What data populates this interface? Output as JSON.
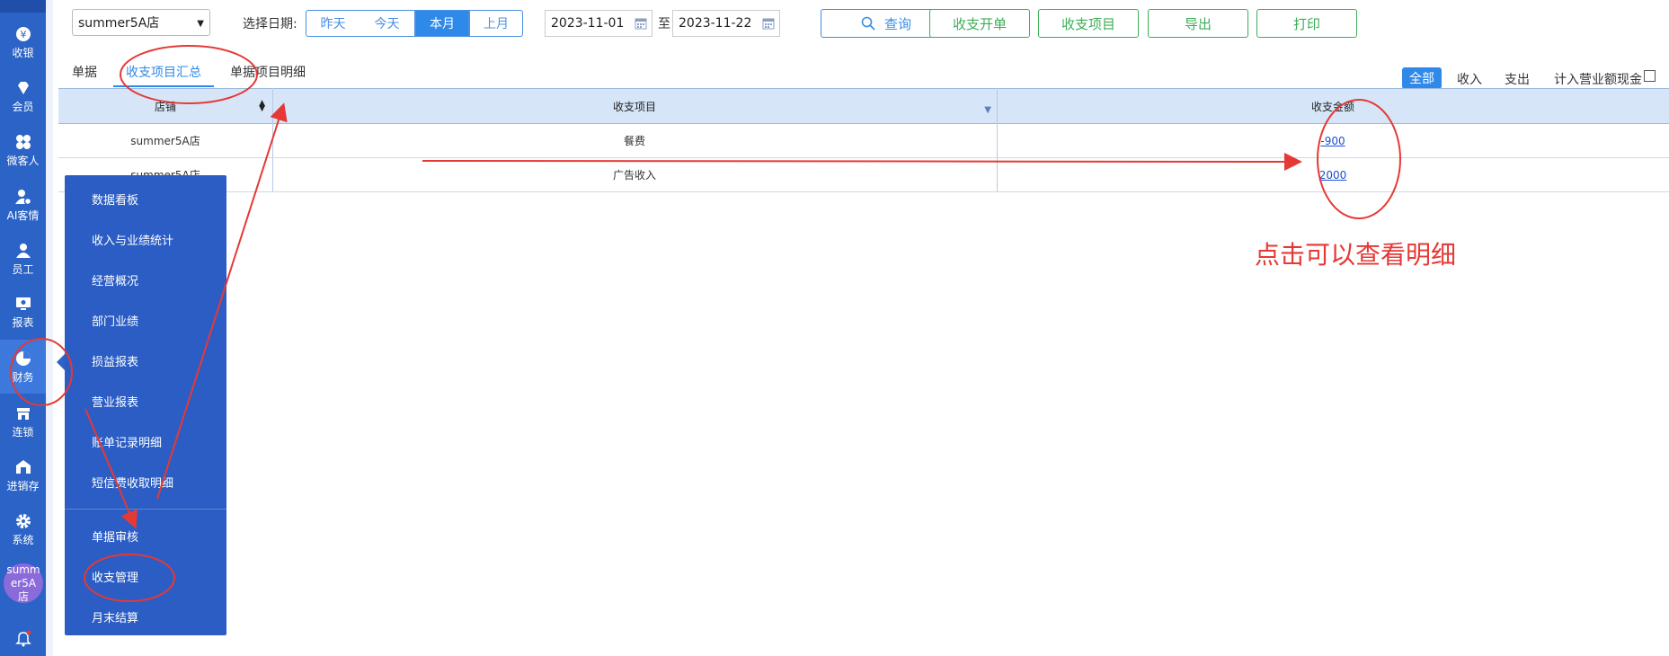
{
  "sidebar": {
    "items": [
      {
        "label": "收银",
        "icon": "yen-icon"
      },
      {
        "label": "会员",
        "icon": "diamond-icon"
      },
      {
        "label": "微客人",
        "icon": "clover-icon"
      },
      {
        "label": "AI客情",
        "icon": "person-gear-icon"
      },
      {
        "label": "员工",
        "icon": "person-icon"
      },
      {
        "label": "报表",
        "icon": "monitor-icon"
      },
      {
        "label": "财务",
        "icon": "pie-icon",
        "active": true
      },
      {
        "label": "连锁",
        "icon": "store-icon"
      },
      {
        "label": "进销存",
        "icon": "warehouse-icon"
      },
      {
        "label": "系统",
        "icon": "gear-icon"
      }
    ],
    "avatar": "summer5A店"
  },
  "finance_menu": {
    "items": [
      "数据看板",
      "收入与业绩统计",
      "经营概况",
      "部门业绩",
      "损益报表",
      "营业报表",
      "账单记录明细",
      "短信费收取明细"
    ],
    "items2": [
      "单据审核",
      "收支管理",
      "月末结算"
    ]
  },
  "toolbar": {
    "store": "summer5A店",
    "date_label": "选择日期:",
    "ranges": [
      "昨天",
      "今天",
      "本月",
      "上月"
    ],
    "active_range": "本月",
    "start_date": "2023-11-01",
    "end_date": "2023-11-22",
    "to": "至",
    "buttons": {
      "query": "查询",
      "open_bill": "收支开单",
      "items": "收支项目",
      "export": "导出",
      "print": "打印"
    }
  },
  "tabs": [
    "单据",
    "收支项目汇总",
    "单据项目明细"
  ],
  "filters": [
    "全部",
    "收入",
    "支出"
  ],
  "include_cash_label": "计入营业额现金",
  "table": {
    "headers": [
      "店铺",
      "收支项目",
      "收支金额"
    ],
    "rows": [
      {
        "store": "summer5A店",
        "item": "餐费",
        "amount": "-900"
      },
      {
        "store": "summer5A店",
        "item": "广告收入",
        "amount": "2000"
      }
    ]
  },
  "annotation": "点击可以查看明细",
  "colors": {
    "sidebar": "#2b63c6",
    "accent": "#2e89e8",
    "green": "#3dae59",
    "annot": "#e53935"
  }
}
